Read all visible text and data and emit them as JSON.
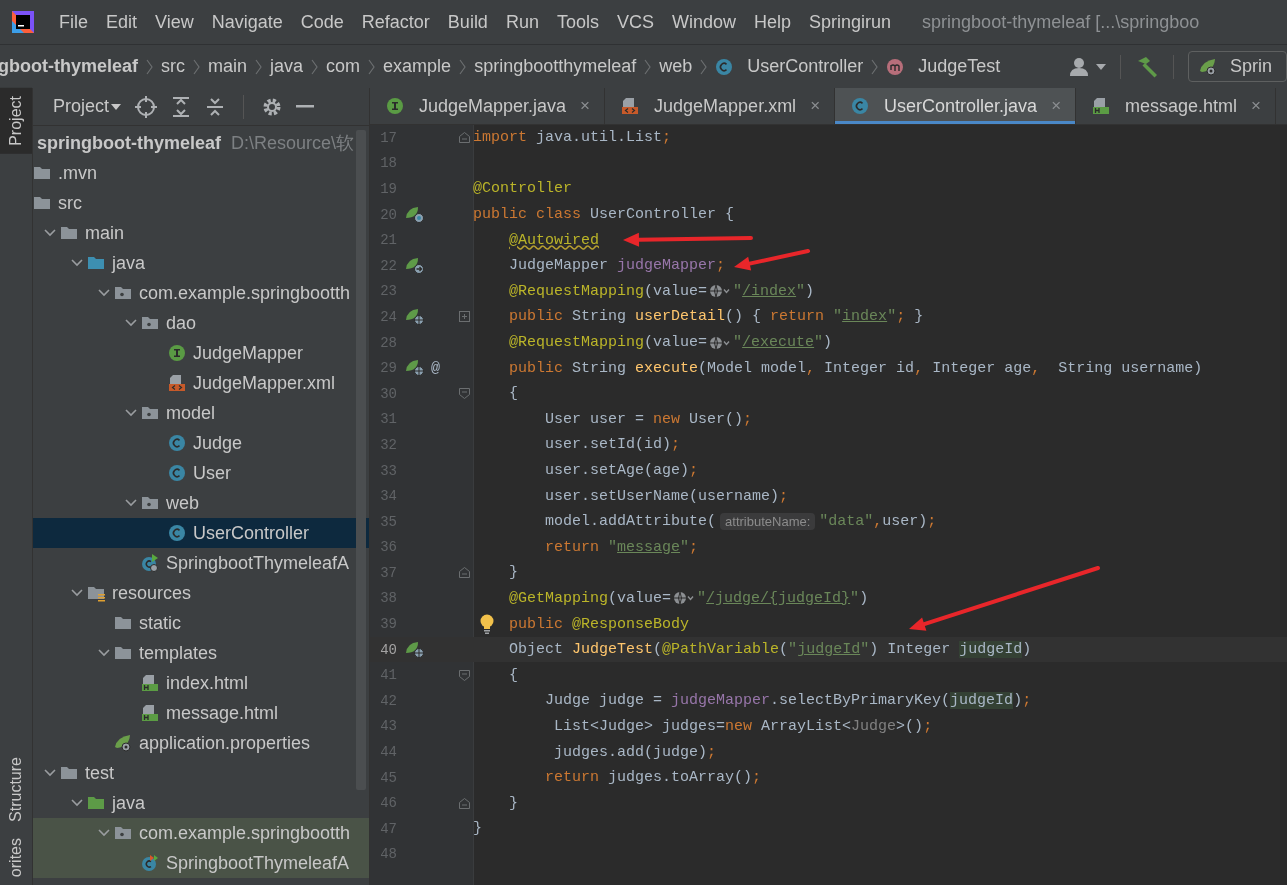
{
  "menu_bar": {
    "items": [
      "File",
      "Edit",
      "View",
      "Navigate",
      "Code",
      "Refactor",
      "Build",
      "Run",
      "Tools",
      "VCS",
      "Window",
      "Help",
      "Springirun"
    ],
    "title": "springboot-thymeleaf [...\\springboo"
  },
  "breadcrumbs": {
    "root": "gboot-thymeleaf",
    "items": [
      {
        "label": "src"
      },
      {
        "label": "main"
      },
      {
        "label": "java"
      },
      {
        "label": "com"
      },
      {
        "label": "example"
      },
      {
        "label": "springbootthymeleaf"
      },
      {
        "label": "web"
      },
      {
        "label": "UserController",
        "kind": "class"
      },
      {
        "label": "JudgeTest",
        "kind": "method"
      }
    ],
    "run_config": "Sprin"
  },
  "tool_stripe": {
    "top": [
      {
        "label": "Project",
        "selected": true
      }
    ],
    "bottom": [
      {
        "label": "Structure",
        "selected": false
      },
      {
        "label": "orites",
        "selected": false
      }
    ]
  },
  "project_panel": {
    "title": "Project",
    "tree": {
      "label": "springboot-thymeleaf",
      "path": "D:\\Resource\\软",
      "selected": false,
      "children": [
        {
          "label": ".mvn",
          "kind": "folder",
          "selected": false
        },
        {
          "label": "src",
          "kind": "folder",
          "selected": false,
          "children": [
            {
              "label": "main",
              "kind": "folder",
              "expanded": true,
              "selected": false,
              "children": [
                {
                  "label": "java",
                  "kind": "source-folder",
                  "expanded": true,
                  "selected": false,
                  "children": [
                    {
                      "label": "com.example.springbootth",
                      "kind": "package",
                      "expanded": true,
                      "selected": false,
                      "children": [
                        {
                          "label": "dao",
                          "kind": "package",
                          "expanded": true,
                          "selected": false,
                          "children": [
                            {
                              "label": "JudgeMapper",
                              "kind": "interface",
                              "selected": false
                            },
                            {
                              "label": "JudgeMapper.xml",
                              "kind": "xml",
                              "selected": false
                            }
                          ]
                        },
                        {
                          "label": "model",
                          "kind": "package",
                          "expanded": true,
                          "selected": false,
                          "children": [
                            {
                              "label": "Judge",
                              "kind": "class",
                              "selected": false
                            },
                            {
                              "label": "User",
                              "kind": "class",
                              "selected": false
                            }
                          ]
                        },
                        {
                          "label": "web",
                          "kind": "package",
                          "expanded": true,
                          "selected": false,
                          "children": [
                            {
                              "label": "UserController",
                              "kind": "class",
                              "selected": true
                            }
                          ]
                        },
                        {
                          "label": "SpringbootThymeleafA",
                          "kind": "spring-app",
                          "selected": false
                        }
                      ]
                    }
                  ]
                },
                {
                  "label": "resources",
                  "kind": "resources-folder",
                  "expanded": true,
                  "selected": false,
                  "children": [
                    {
                      "label": "static",
                      "kind": "folder",
                      "selected": false
                    },
                    {
                      "label": "templates",
                      "kind": "folder",
                      "expanded": true,
                      "selected": false,
                      "children": [
                        {
                          "label": "index.html",
                          "kind": "html",
                          "selected": false
                        },
                        {
                          "label": "message.html",
                          "kind": "html",
                          "selected": false
                        }
                      ]
                    },
                    {
                      "label": "application.properties",
                      "kind": "properties",
                      "selected": false
                    }
                  ]
                }
              ]
            },
            {
              "label": "test",
              "kind": "folder",
              "expanded": true,
              "selected": false,
              "children": [
                {
                  "label": "java",
                  "kind": "test-source-folder",
                  "expanded": true,
                  "selected": false,
                  "children": [
                    {
                      "label": "com.example.springbootth",
                      "kind": "package",
                      "expanded": true,
                      "selected": false,
                      "children": [
                        {
                          "label": "SpringbootThymeleafA",
                          "kind": "test-class",
                          "selected": false
                        }
                      ]
                    }
                  ]
                }
              ]
            }
          ]
        }
      ]
    }
  },
  "tabs": [
    {
      "label": "JudgeMapper.java",
      "kind": "interface",
      "close": "×",
      "selected": false
    },
    {
      "label": "JudgeMapper.xml",
      "kind": "xml",
      "close": "×",
      "selected": false
    },
    {
      "label": "UserController.java",
      "kind": "class",
      "close": "×",
      "selected": true
    },
    {
      "label": "message.html",
      "kind": "html",
      "close": "×",
      "selected": false
    }
  ],
  "editor": {
    "lines": [
      {
        "number": "17",
        "current": false,
        "fold": {
          "kind": "end"
        },
        "segments": [
          {
            "kind": "code",
            "tokens": [
              {
                "kind": "kw",
                "text": "import"
              },
              {
                "kind": "plain",
                "text": " java.util.List"
              },
              {
                "kind": "kw",
                "text": ";"
              }
            ]
          }
        ]
      },
      {
        "number": "18",
        "current": false
      },
      {
        "number": "19",
        "current": false,
        "segments": [
          {
            "kind": "code",
            "tokens": [
              {
                "kind": "ann",
                "text": "@Controller"
              }
            ]
          }
        ]
      },
      {
        "number": "20",
        "current": false,
        "gutter_icon": {
          "kind": "bean"
        },
        "segments": [
          {
            "kind": "code",
            "tokens": [
              {
                "kind": "kw",
                "text": "public class"
              },
              {
                "kind": "plain",
                "text": " UserController {"
              }
            ]
          }
        ]
      },
      {
        "number": "21",
        "current": false,
        "arrow": {
          "kind": "flat"
        },
        "segments": [
          {
            "kind": "code",
            "tokens": [
              {
                "kind": "warn",
                "text": "    @Autowired"
              }
            ]
          }
        ]
      },
      {
        "number": "22",
        "current": false,
        "gutter_icon": {
          "kind": "bean-link"
        },
        "arrow": {
          "kind": "rising"
        },
        "segments": [
          {
            "kind": "code",
            "tokens": [
              {
                "kind": "plain",
                "text": "    JudgeMapper "
              },
              {
                "kind": "field",
                "text": "judgeMapper"
              },
              {
                "kind": "kw",
                "text": ";"
              }
            ]
          }
        ]
      },
      {
        "number": "23",
        "current": false,
        "segments": [
          {
            "kind": "code",
            "tokens": [
              {
                "kind": "ann",
                "text": "    @RequestMapping"
              },
              {
                "kind": "plain",
                "text": "(value="
              }
            ]
          },
          {
            "kind": "globe"
          },
          {
            "kind": "code",
            "tokens": [
              {
                "kind": "str",
                "text": "\""
              },
              {
                "kind": "link",
                "text": "/index"
              },
              {
                "kind": "str",
                "text": "\""
              },
              {
                "kind": "plain",
                "text": ")"
              }
            ]
          }
        ]
      },
      {
        "number": "24",
        "current": false,
        "gutter_icon": {
          "kind": "web"
        },
        "fold": {
          "kind": "collapsed"
        },
        "segments": [
          {
            "kind": "code",
            "tokens": [
              {
                "kind": "kw",
                "text": "    public"
              },
              {
                "kind": "plain",
                "text": " String "
              },
              {
                "kind": "method",
                "text": "userDetail"
              },
              {
                "kind": "plain",
                "text": "() { "
              },
              {
                "kind": "kw",
                "text": "return "
              },
              {
                "kind": "str",
                "text": "\""
              },
              {
                "kind": "link",
                "text": "index"
              },
              {
                "kind": "str",
                "text": "\""
              },
              {
                "kind": "kw",
                "text": ";"
              },
              {
                "kind": "plain",
                "text": " }"
              }
            ]
          }
        ]
      },
      {
        "number": "28",
        "current": false,
        "segments": [
          {
            "kind": "code",
            "tokens": [
              {
                "kind": "ann",
                "text": "    @RequestMapping"
              },
              {
                "kind": "plain",
                "text": "(value="
              }
            ]
          },
          {
            "kind": "globe"
          },
          {
            "kind": "code",
            "tokens": [
              {
                "kind": "str",
                "text": "\""
              },
              {
                "kind": "link",
                "text": "/execute"
              },
              {
                "kind": "str",
                "text": "\""
              },
              {
                "kind": "plain",
                "text": ")"
              }
            ]
          }
        ]
      },
      {
        "number": "29",
        "current": false,
        "gutter_icon": {
          "kind": "web"
        },
        "gutter_mark": "@",
        "segments": [
          {
            "kind": "code",
            "tokens": [
              {
                "kind": "kw",
                "text": "    public"
              },
              {
                "kind": "plain",
                "text": " String "
              },
              {
                "kind": "method",
                "text": "execute"
              },
              {
                "kind": "plain",
                "text": "(Model model"
              },
              {
                "kind": "kw",
                "text": ","
              },
              {
                "kind": "plain",
                "text": " Integer id"
              },
              {
                "kind": "kw",
                "text": ","
              },
              {
                "kind": "plain",
                "text": " Integer age"
              },
              {
                "kind": "kw",
                "text": ","
              },
              {
                "kind": "plain",
                "text": "  String username)"
              }
            ]
          }
        ]
      },
      {
        "number": "30",
        "current": false,
        "fold": {
          "kind": "start"
        },
        "segments": [
          {
            "kind": "code",
            "tokens": [
              {
                "kind": "plain",
                "text": "    {"
              }
            ]
          }
        ]
      },
      {
        "number": "31",
        "current": false,
        "segments": [
          {
            "kind": "code",
            "tokens": [
              {
                "kind": "plain",
                "text": "        User user = "
              },
              {
                "kind": "kw",
                "text": "new"
              },
              {
                "kind": "plain",
                "text": " User()"
              },
              {
                "kind": "kw",
                "text": ";"
              }
            ]
          }
        ]
      },
      {
        "number": "32",
        "current": false,
        "segments": [
          {
            "kind": "code",
            "tokens": [
              {
                "kind": "plain",
                "text": "        user.setId(id)"
              },
              {
                "kind": "kw",
                "text": ";"
              }
            ]
          }
        ]
      },
      {
        "number": "33",
        "current": false,
        "segments": [
          {
            "kind": "code",
            "tokens": [
              {
                "kind": "plain",
                "text": "        user.setAge(age)"
              },
              {
                "kind": "kw",
                "text": ";"
              }
            ]
          }
        ]
      },
      {
        "number": "34",
        "current": false,
        "segments": [
          {
            "kind": "code",
            "tokens": [
              {
                "kind": "plain",
                "text": "        user.setUserName(username)"
              },
              {
                "kind": "kw",
                "text": ";"
              }
            ]
          }
        ]
      },
      {
        "number": "35",
        "current": false,
        "segments": [
          {
            "kind": "code",
            "tokens": [
              {
                "kind": "plain",
                "text": "        model.addAttribute("
              }
            ]
          },
          {
            "kind": "hint",
            "text": "attributeName:"
          },
          {
            "kind": "code",
            "tokens": [
              {
                "kind": "str",
                "text": "\"data\""
              },
              {
                "kind": "kw",
                "text": ","
              },
              {
                "kind": "plain",
                "text": "user)"
              },
              {
                "kind": "kw",
                "text": ";"
              }
            ]
          }
        ]
      },
      {
        "number": "36",
        "current": false,
        "segments": [
          {
            "kind": "code",
            "tokens": [
              {
                "kind": "kw",
                "text": "        return"
              },
              {
                "kind": "str",
                "text": " \""
              },
              {
                "kind": "link",
                "text": "message"
              },
              {
                "kind": "str",
                "text": "\""
              },
              {
                "kind": "kw",
                "text": ";"
              }
            ]
          }
        ]
      },
      {
        "number": "37",
        "current": false,
        "fold": {
          "kind": "end"
        },
        "segments": [
          {
            "kind": "code",
            "tokens": [
              {
                "kind": "plain",
                "text": "    }"
              }
            ]
          }
        ]
      },
      {
        "number": "38",
        "current": false,
        "segments": [
          {
            "kind": "code",
            "tokens": [
              {
                "kind": "ann",
                "text": "    @GetMapping"
              },
              {
                "kind": "plain",
                "text": "(value="
              }
            ]
          },
          {
            "kind": "globe"
          },
          {
            "kind": "code",
            "tokens": [
              {
                "kind": "str",
                "text": "\""
              },
              {
                "kind": "link",
                "text": "/judge/{judgeId}"
              },
              {
                "kind": "str",
                "text": "\""
              },
              {
                "kind": "plain",
                "text": ")"
              }
            ]
          }
        ]
      },
      {
        "number": "39",
        "current": false,
        "bulb": true,
        "arrow": {
          "kind": "steep"
        },
        "segments": [
          {
            "kind": "code",
            "tokens": [
              {
                "kind": "kw",
                "text": "    public "
              },
              {
                "kind": "ann",
                "text": "@ResponseBody"
              }
            ]
          }
        ]
      },
      {
        "number": "40",
        "current": true,
        "gutter_icon": {
          "kind": "web"
        },
        "segments": [
          {
            "kind": "code",
            "tokens": [
              {
                "kind": "plain",
                "text": "    Object "
              },
              {
                "kind": "method",
                "text": "JudgeTest"
              },
              {
                "kind": "plain",
                "text": "("
              },
              {
                "kind": "ann",
                "text": "@PathVariable"
              },
              {
                "kind": "plain",
                "text": "("
              },
              {
                "kind": "str",
                "text": "\""
              },
              {
                "kind": "link",
                "text": "judgeId"
              },
              {
                "kind": "str",
                "text": "\""
              },
              {
                "kind": "plain",
                "text": ") Integer "
              },
              {
                "kind": "match",
                "text": "judgeId"
              },
              {
                "kind": "plain",
                "text": ")"
              }
            ]
          }
        ]
      },
      {
        "number": "41",
        "current": false,
        "fold": {
          "kind": "start"
        },
        "segments": [
          {
            "kind": "code",
            "tokens": [
              {
                "kind": "plain",
                "text": "    {"
              }
            ]
          }
        ]
      },
      {
        "number": "42",
        "current": false,
        "segments": [
          {
            "kind": "code",
            "tokens": [
              {
                "kind": "plain",
                "text": "        Judge judge = "
              },
              {
                "kind": "field",
                "text": "judgeMapper"
              },
              {
                "kind": "plain",
                "text": ".selectByPrimaryKey("
              },
              {
                "kind": "match",
                "text": "judgeId"
              },
              {
                "kind": "plain",
                "text": ")"
              },
              {
                "kind": "kw",
                "text": ";"
              }
            ]
          }
        ]
      },
      {
        "number": "43",
        "current": false,
        "segments": [
          {
            "kind": "code",
            "tokens": [
              {
                "kind": "plain",
                "text": "         List<Judge> judges="
              },
              {
                "kind": "kw",
                "text": "new"
              },
              {
                "kind": "plain",
                "text": " ArrayList<"
              },
              {
                "kind": "gray",
                "text": "Judge"
              },
              {
                "kind": "plain",
                "text": ">()"
              },
              {
                "kind": "kw",
                "text": ";"
              }
            ]
          }
        ]
      },
      {
        "number": "44",
        "current": false,
        "segments": [
          {
            "kind": "code",
            "tokens": [
              {
                "kind": "plain",
                "text": "         judges.add(judge)"
              },
              {
                "kind": "kw",
                "text": ";"
              }
            ]
          }
        ]
      },
      {
        "number": "45",
        "current": false,
        "segments": [
          {
            "kind": "code",
            "tokens": [
              {
                "kind": "kw",
                "text": "        return"
              },
              {
                "kind": "plain",
                "text": " judges.toArray()"
              },
              {
                "kind": "kw",
                "text": ";"
              }
            ]
          }
        ]
      },
      {
        "number": "46",
        "current": false,
        "fold": {
          "kind": "end"
        },
        "segments": [
          {
            "kind": "code",
            "tokens": [
              {
                "kind": "plain",
                "text": "    }"
              }
            ]
          }
        ]
      },
      {
        "number": "47",
        "current": false,
        "segments": [
          {
            "kind": "code",
            "tokens": [
              {
                "kind": "plain",
                "text": "}"
              }
            ]
          }
        ]
      },
      {
        "number": "48",
        "current": false
      }
    ]
  }
}
